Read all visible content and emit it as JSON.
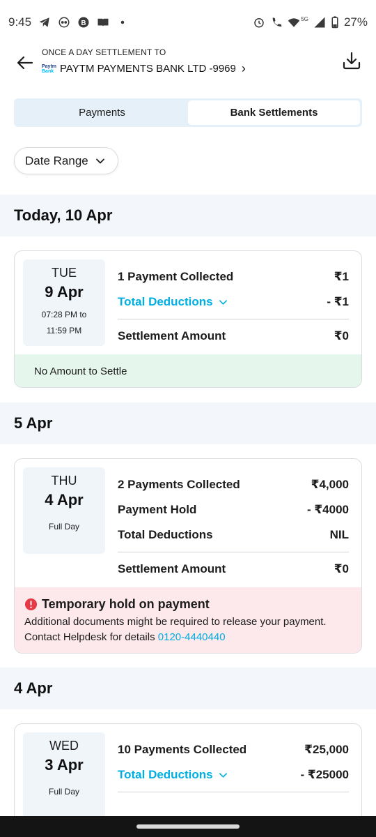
{
  "status_bar": {
    "time": "9:45",
    "battery": "27%",
    "network": "5G",
    "left_icons": [
      "telegram-icon",
      "app-icon",
      "b-icon",
      "book-icon",
      "dot-icon"
    ],
    "right_icons": [
      "alarm-icon",
      "wifi-call-icon",
      "wifi-icon",
      "signal-icon",
      "battery-icon"
    ]
  },
  "header": {
    "subtitle": "ONCE A DAY SETTLEMENT TO",
    "logo_top": "Paytm",
    "logo_bottom": "Bank",
    "bank_name": "PAYTM PAYMENTS BANK LTD -9969",
    "chevron": "›"
  },
  "tabs": [
    {
      "label": "Payments",
      "active": false
    },
    {
      "label": "Bank Settlements",
      "active": true
    }
  ],
  "filter": {
    "date_range_label": "Date Range"
  },
  "sections": [
    {
      "title": "Today, 10 Apr",
      "card": {
        "day": "TUE",
        "date": "9 Apr",
        "time_from": "07:28 PM to",
        "time_to": "11:59 PM",
        "rows": [
          {
            "label": "1 Payment Collected",
            "value": "₹1"
          },
          {
            "label": "Total Deductions",
            "value": "- ₹1",
            "expandable": true
          }
        ],
        "settlement_label": "Settlement Amount",
        "settlement_value": "₹0",
        "note": "No Amount to Settle"
      }
    },
    {
      "title": "5 Apr",
      "card": {
        "day": "THU",
        "date": "4 Apr",
        "time_from": "Full Day",
        "rows": [
          {
            "label": "2 Payments Collected",
            "value": "₹4,000"
          },
          {
            "label": "Payment Hold",
            "value": "- ₹4000"
          },
          {
            "label": "Total Deductions",
            "value": "NIL"
          }
        ],
        "settlement_label": "Settlement Amount",
        "settlement_value": "₹0",
        "alert": {
          "title": "Temporary hold on payment",
          "line1": "Additional documents might be required to release your payment.",
          "line2": "Contact Helpdesk for details",
          "phone": "0120-4440440"
        }
      }
    },
    {
      "title": "4 Apr",
      "card": {
        "day": "WED",
        "date": "3 Apr",
        "time_from": "Full Day",
        "rows": [
          {
            "label": "10 Payments Collected",
            "value": "₹25,000"
          },
          {
            "label": "Total Deductions",
            "value": "- ₹25000",
            "expandable": true
          }
        ]
      }
    }
  ],
  "colors": {
    "accent_blue": "#00aee0",
    "success_bg": "#e5f6ec",
    "alert_bg": "#fde8ec",
    "alert_icon": "#e53946",
    "section_bg": "#f3f7fb",
    "tab_bg": "#e6f0f8"
  }
}
